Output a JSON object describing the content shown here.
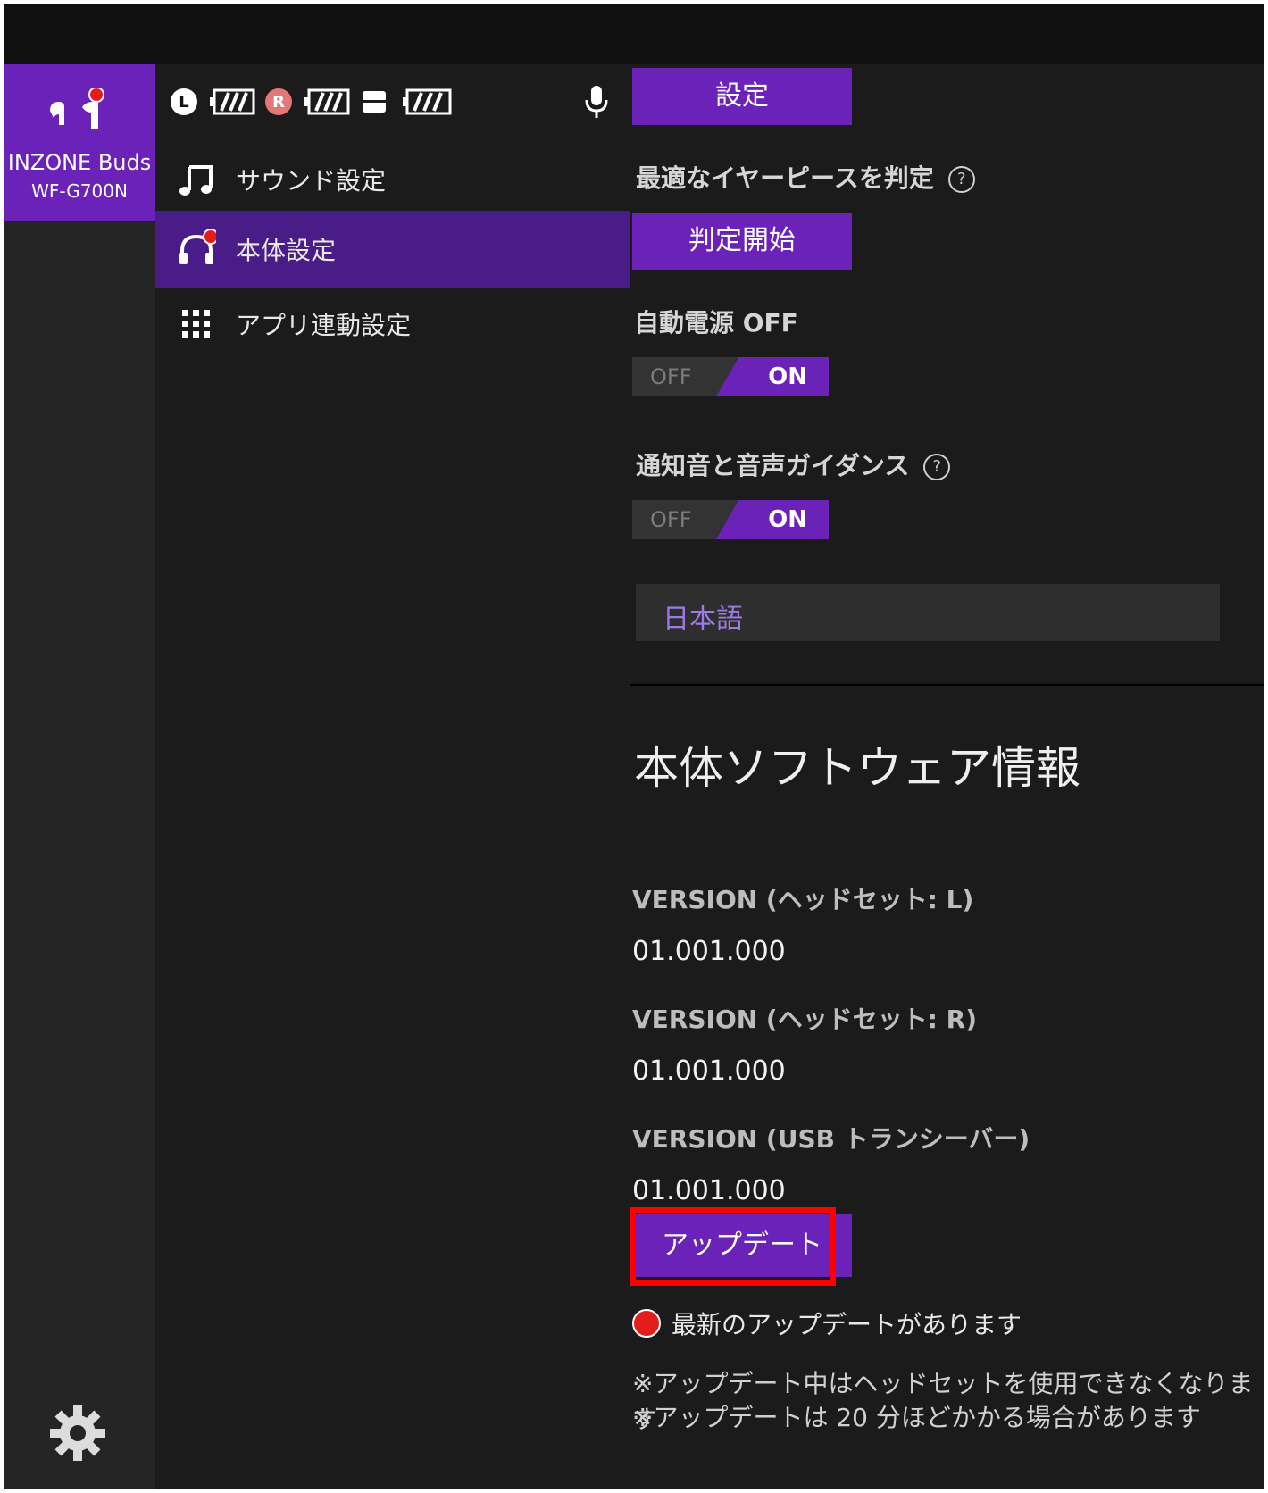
{
  "device": {
    "name": "INZONE Buds",
    "model": "WF-G700N"
  },
  "status": {
    "left_label": "L",
    "right_label": "R"
  },
  "menu": {
    "items": [
      {
        "label": "サウンド設定",
        "icon": "music-note-icon"
      },
      {
        "label": "本体設定",
        "icon": "headphones-icon"
      },
      {
        "label": "アプリ連動設定",
        "icon": "grid-icon"
      }
    ]
  },
  "settings": {
    "settings_button": "設定",
    "earpiece_label": "最適なイヤーピースを判定",
    "earpiece_button": "判定開始",
    "auto_power_label": "自動電源 OFF",
    "auto_power_toggle": {
      "off": "OFF",
      "on": "ON"
    },
    "notify_label": "通知音と音声ガイダンス",
    "notify_toggle": {
      "off": "OFF",
      "on": "ON"
    },
    "language": "日本語",
    "help_symbol": "?"
  },
  "software": {
    "title": "本体ソフトウェア情報",
    "versions": [
      {
        "label": "VERSION (ヘッドセット: L)",
        "value": "01.001.000"
      },
      {
        "label": "VERSION (ヘッドセット: R)",
        "value": "01.001.000"
      },
      {
        "label": "VERSION (USB トランシーバー)",
        "value": "01.001.000"
      }
    ],
    "update_button": "アップデート",
    "update_notice": "最新のアップデートがあります",
    "note1": "※アップデート中はヘッドセットを使用できなくなります",
    "note2": "※アップデートは 20 分ほどかかる場合があります"
  },
  "colors": {
    "accent": "#6a22b8",
    "active_menu": "#4a1c88",
    "background": "#1b1b1b",
    "rail": "#252525",
    "highlight": "#ff0000",
    "notice_dot": "#e51c1c"
  }
}
